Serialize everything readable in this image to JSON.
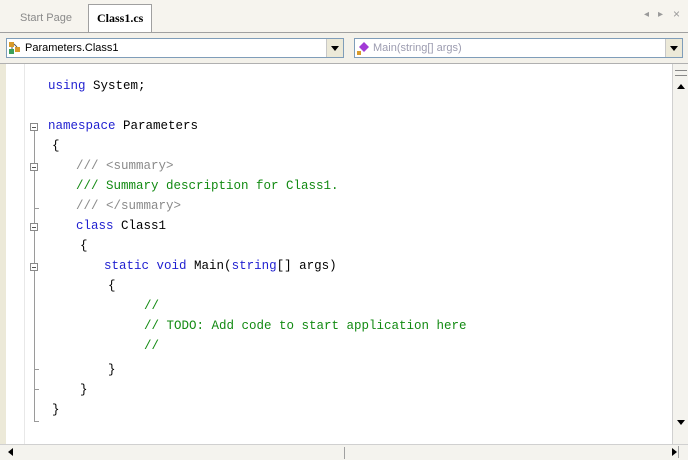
{
  "tabs": {
    "start_page": "Start Page",
    "active": "Class1.cs"
  },
  "tab_controls": {
    "scroll_left": "◂",
    "scroll_right": "▸",
    "close": "×"
  },
  "navbar": {
    "type_combo": "Parameters.Class1",
    "member_combo": "Main(string[] args)"
  },
  "code": {
    "l1_kw": "using",
    "l1_rest": " System;",
    "l3_kw": "namespace",
    "l3_rest": " Parameters",
    "l4": "{",
    "l5_slashes": "///",
    "l5_tag": " <summary>",
    "l6": "/// Summary description for Class1.",
    "l7_slashes": "///",
    "l7_tag": " </summary>",
    "l8_kw": "class",
    "l8_rest": " Class1",
    "l9": "{",
    "l10_kw1": "static",
    "l10_kw2": "void",
    "l10_mid": " Main(",
    "l10_kw3": "string",
    "l10_rest": "[] args)",
    "l11": "{",
    "l12": "//",
    "l13": "// TODO: Add code to start application here",
    "l14": "//",
    "l15": "}",
    "l16": "}",
    "l17": "}"
  },
  "colors": {
    "keyword": "#1f1fd0",
    "comment": "#128a12",
    "xmldoc": "#8a8a8a"
  }
}
